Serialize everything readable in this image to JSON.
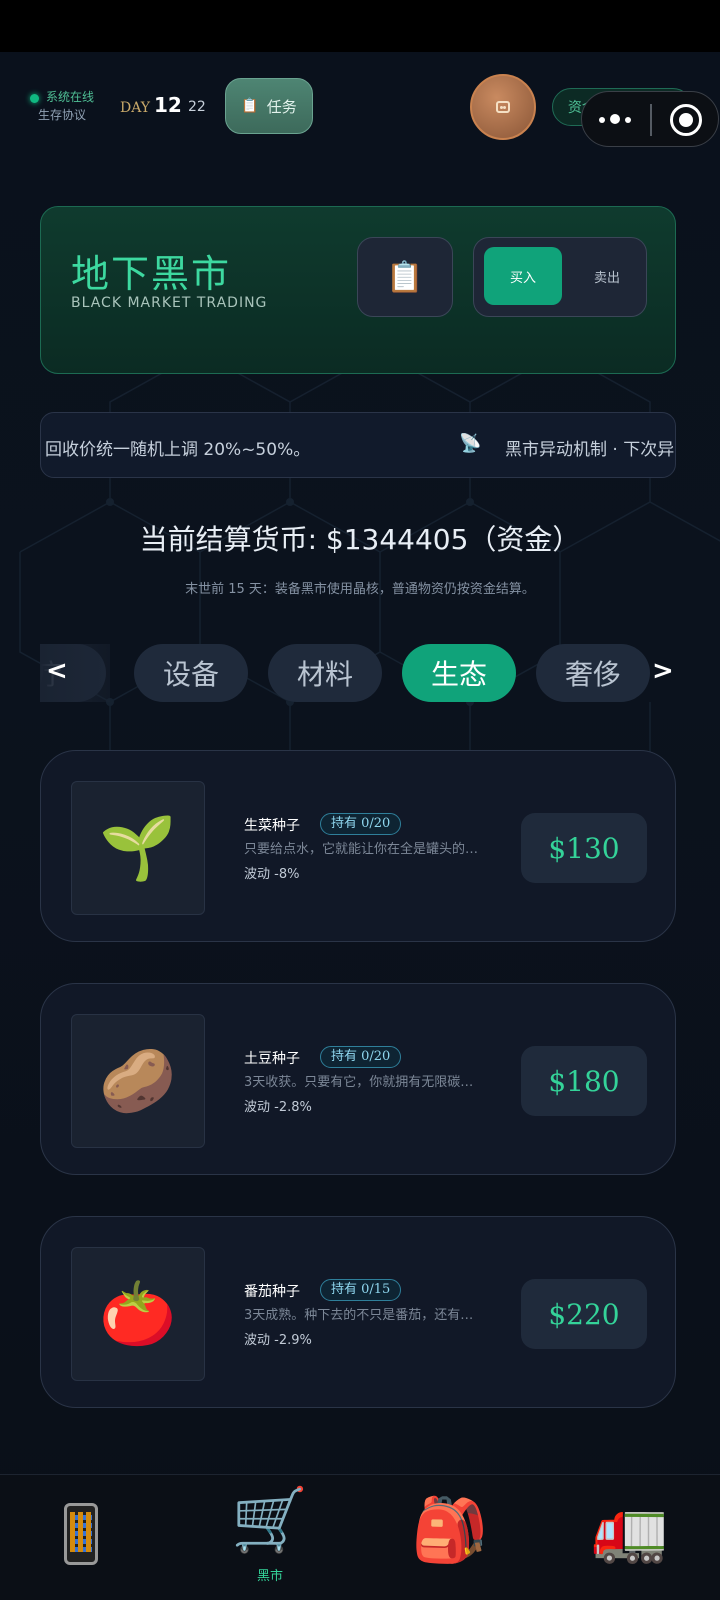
{
  "status": {
    "system_online": "系统在线",
    "protocol": "生存协议",
    "day_label": "DAY",
    "day": "12",
    "day_sub": "22"
  },
  "task_button": {
    "icon": "clipboard-icon",
    "label": "任务"
  },
  "avatar": {
    "icon": "radio-icon"
  },
  "funds": {
    "label": "资金",
    "value": "1344405"
  },
  "header": {
    "title": "地下黑市",
    "subtitle": "BLACK MARKET TRADING",
    "buy": "买入",
    "sell": "卖出",
    "clip_icon": "clipboard-icon"
  },
  "ticker": {
    "text1": "回收价统一随机上调 20%~50%。",
    "icon": "satellite-dish-icon",
    "text2": "黑市异动机制 · 下次异"
  },
  "currency_line": "当前结算货币: $1344405（资金）",
  "note": "末世前 15 天：装备黑市使用晶核，普通物资仍按资金结算。",
  "tabs": [
    "疗",
    "设备",
    "材料",
    "生态",
    "奢侈"
  ],
  "active_tab": "生态",
  "arrows": {
    "left": "<",
    "right": ">"
  },
  "products": [
    {
      "icon": "🌱",
      "name": "生菜种子",
      "owned": "持有 0/20",
      "desc": "只要给点水，它就能让你在全是罐头的…",
      "fluct": "波动 -8%",
      "price": "$130"
    },
    {
      "icon": "🥔",
      "name": "土豆种子",
      "owned": "持有 0/20",
      "desc": "3天收获。只要有它，你就拥有无限碳…",
      "fluct": "波动 -2.8%",
      "price": "$180"
    },
    {
      "icon": "🍅",
      "name": "番茄种子",
      "owned": "持有 0/15",
      "desc": "3天成熟。种下去的不只是番茄，还有…",
      "fluct": "波动 -2.9%",
      "price": "$220"
    }
  ],
  "nav": [
    {
      "icon": "phone-icon",
      "label": ""
    },
    {
      "icon": "🛒",
      "label": "黑市"
    },
    {
      "icon": "🎒",
      "label": ""
    },
    {
      "icon": "🚛",
      "label": ""
    }
  ]
}
